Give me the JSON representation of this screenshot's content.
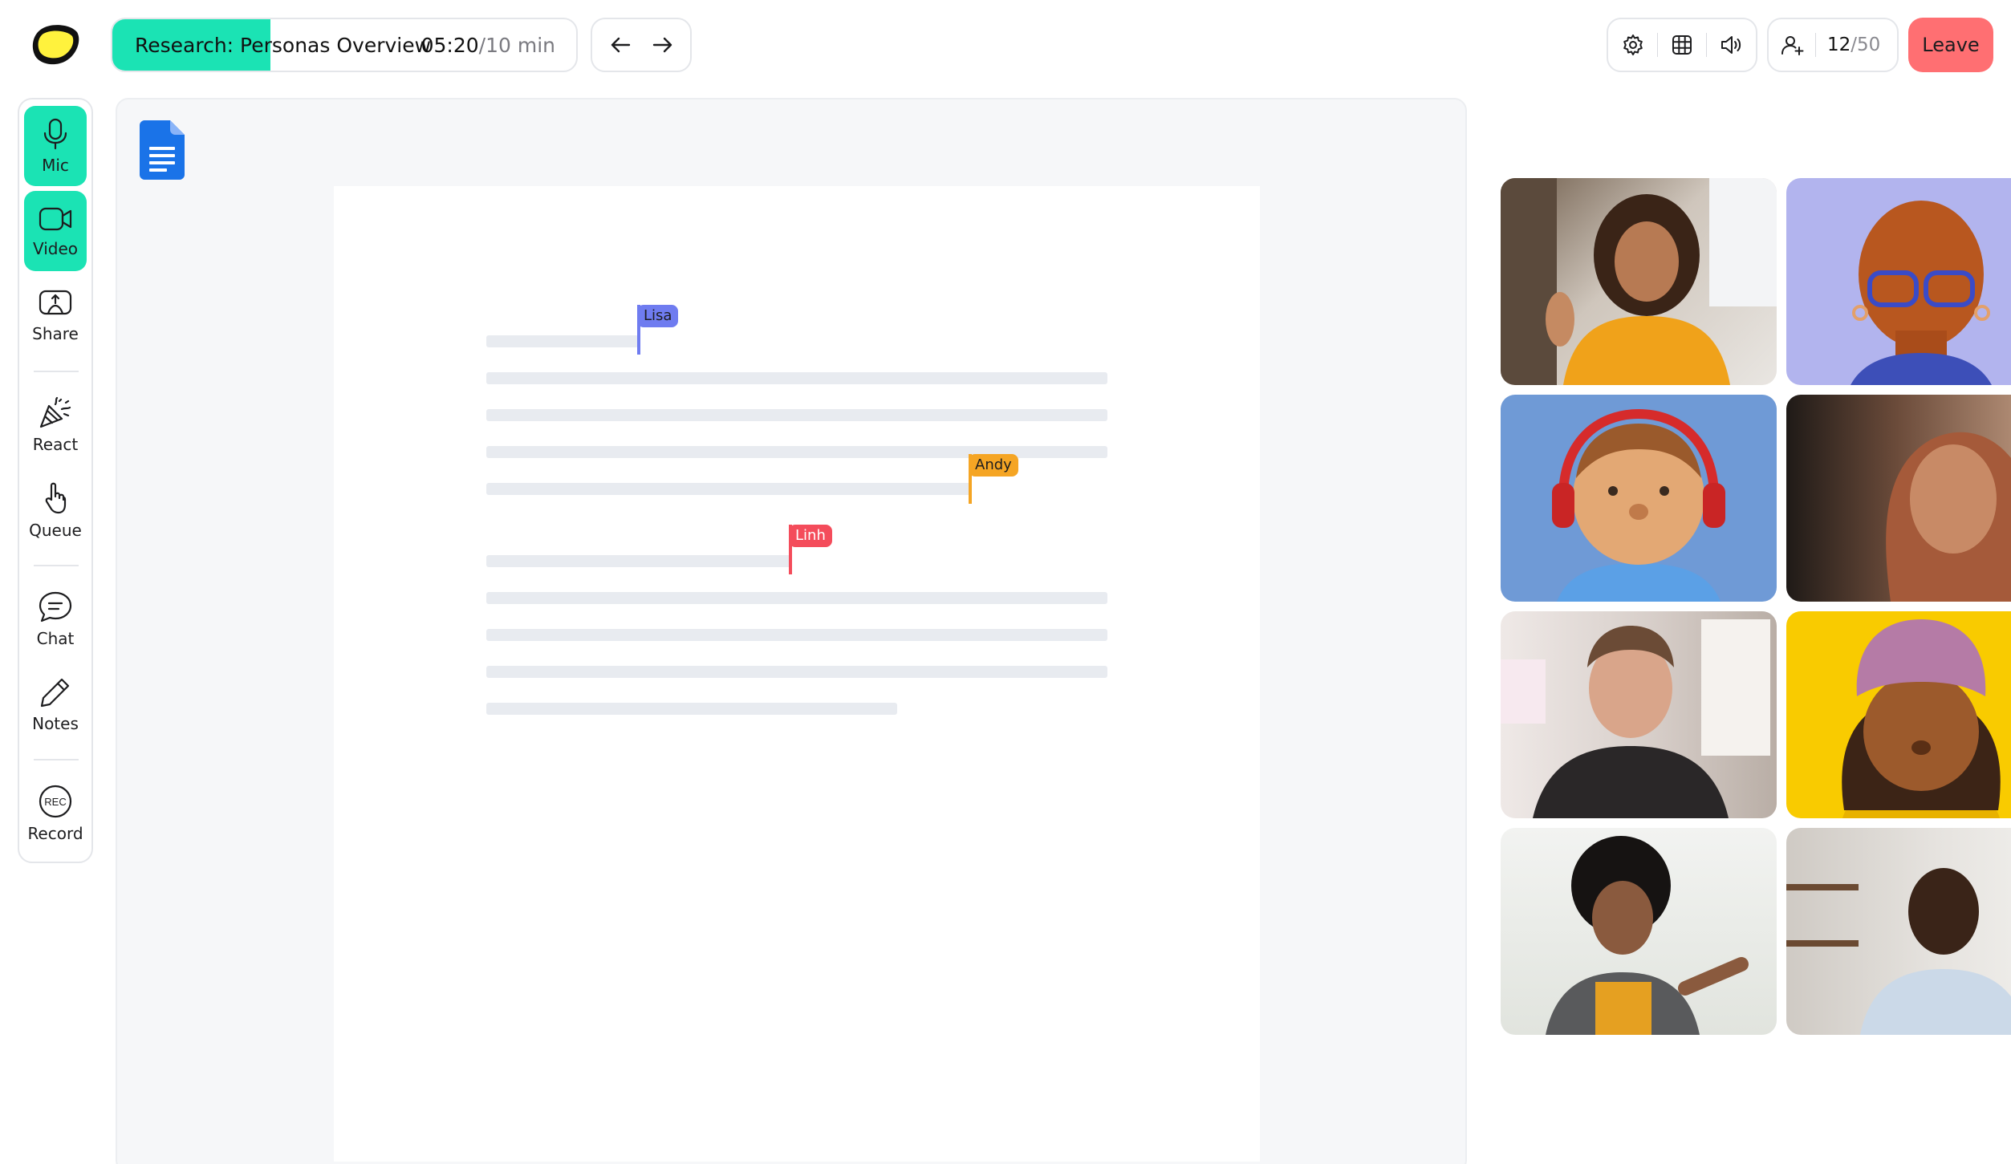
{
  "header": {
    "agenda_title": "Research: Personas Overview",
    "agenda_progress_percent": 34,
    "time_elapsed": "05:20",
    "time_total": "/10 min",
    "participant_count": "12",
    "participant_max": "/50",
    "leave_label": "Leave"
  },
  "colors": {
    "accent": "#1be3b4",
    "leave": "#ff6f72",
    "logo_fill": "#fff23d",
    "cursor_lisa": "#6f7cf0",
    "cursor_andy": "#f5a524",
    "cursor_linh": "#f44c5b"
  },
  "sidebar": {
    "items": [
      {
        "label": "Mic",
        "icon": "microphone-icon",
        "active": true
      },
      {
        "label": "Video",
        "icon": "video-camera-icon",
        "active": true
      },
      {
        "label": "Share",
        "icon": "screen-share-icon",
        "active": false
      },
      {
        "label": "React",
        "icon": "party-popper-icon",
        "active": false
      },
      {
        "label": "Queue",
        "icon": "raised-hand-icon",
        "active": false
      },
      {
        "label": "Chat",
        "icon": "chat-bubble-icon",
        "active": false
      },
      {
        "label": "Notes",
        "icon": "pencil-icon",
        "active": false
      },
      {
        "label": "Record",
        "icon": "record-icon",
        "active": false
      }
    ],
    "record_badge": "REC"
  },
  "document": {
    "icon": "google-docs-icon",
    "cursors": [
      {
        "name": "Lisa"
      },
      {
        "name": "Andy"
      },
      {
        "name": "Linh"
      }
    ]
  },
  "participants": [
    {
      "name": "participant-1",
      "kind": "camera",
      "bg": "#d9d4cd"
    },
    {
      "name": "participant-2",
      "kind": "avatar",
      "bg": "#b2b4ee"
    },
    {
      "name": "participant-3",
      "kind": "avatar",
      "bg": "#6f9ad6"
    },
    {
      "name": "participant-4",
      "kind": "camera",
      "bg": "#6e5547"
    },
    {
      "name": "participant-5",
      "kind": "camera",
      "bg": "#d8d2cd"
    },
    {
      "name": "participant-6",
      "kind": "avatar",
      "bg": "#f9cb00"
    },
    {
      "name": "participant-7",
      "kind": "camera",
      "bg": "#e3e6e0"
    },
    {
      "name": "participant-8",
      "kind": "camera",
      "bg": "#cfcac4"
    }
  ]
}
